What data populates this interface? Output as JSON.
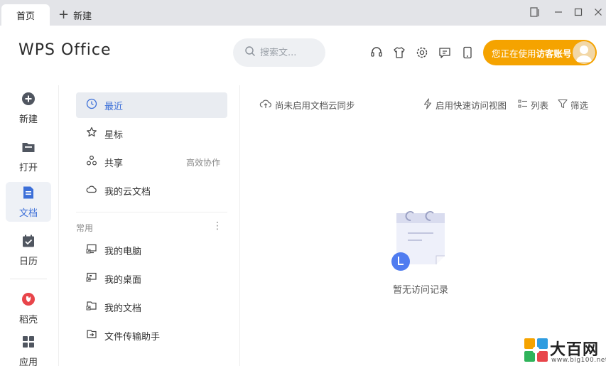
{
  "titlebar": {
    "tab_home": "首页",
    "tab_new": "新建"
  },
  "header": {
    "logo": "WPS Office",
    "search_placeholder": "搜索文...",
    "account_prefix": "您正在使用",
    "account_name": "访客账号",
    "accent_color": "#f5a300"
  },
  "rail": {
    "items": [
      {
        "label": "新建",
        "icon": "plus-circle-icon"
      },
      {
        "label": "打开",
        "icon": "folder-icon"
      },
      {
        "label": "文档",
        "icon": "document-icon"
      },
      {
        "label": "日历",
        "icon": "calendar-icon"
      },
      {
        "label": "稻壳",
        "icon": "docer-icon"
      },
      {
        "label": "应用",
        "icon": "apps-grid-icon"
      }
    ]
  },
  "nav": {
    "items": [
      {
        "label": "最近",
        "icon": "clock-icon"
      },
      {
        "label": "星标",
        "icon": "star-icon"
      },
      {
        "label": "共享",
        "icon": "share-icon",
        "extra": "高效协作"
      },
      {
        "label": "我的云文档",
        "icon": "cloud-icon"
      }
    ],
    "section_label": "常用",
    "common": [
      {
        "label": "我的电脑",
        "icon": "computer-shortcut-icon"
      },
      {
        "label": "我的桌面",
        "icon": "desktop-shortcut-icon"
      },
      {
        "label": "我的文档",
        "icon": "documents-shortcut-icon"
      },
      {
        "label": "文件传输助手",
        "icon": "transfer-icon"
      }
    ]
  },
  "main": {
    "cloud_sync": "尚未启用文档云同步",
    "quick_access": "启用快速访问视图",
    "list": "列表",
    "filter": "筛选",
    "empty_text": "暂无访问记录"
  },
  "watermark": {
    "title": "大百网",
    "subtitle": "www.big100.net"
  }
}
